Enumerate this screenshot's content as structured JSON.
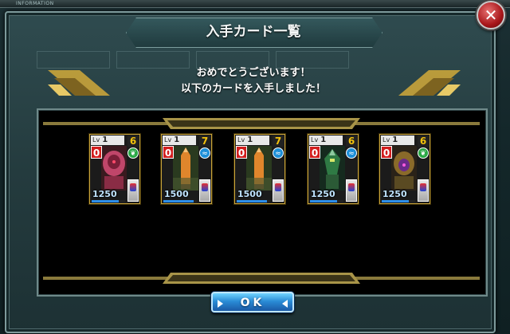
{
  "top_bar": {
    "label": "INFORMATION"
  },
  "dialog": {
    "title": "入手カード一覧",
    "message_line1": "おめでとうございます！",
    "message_line2": "以下のカードを入手しました！",
    "ok_label": "OK",
    "close_symbol": "✕"
  },
  "icons": {
    "close": "close-icon",
    "ok_arrows": "triangle-arrow-icon",
    "attribute_green": "leaf-icon",
    "attribute_blue": "wave-icon"
  },
  "colors": {
    "accent_gold": "#c9a43a",
    "attack_red": "#d21e1e",
    "cost_yellow": "#f3c20c",
    "button_blue": "#2a8cd6",
    "attr_green": "#2aa845",
    "attr_blue": "#1d8fd8"
  },
  "cards": [
    {
      "lv_label": "Lv",
      "level": "1",
      "cost": "6",
      "attack": "0",
      "hp": "1250",
      "attribute": "green",
      "hp_fill": 0.8,
      "art": "pink-mobile-suit"
    },
    {
      "lv_label": "Lv",
      "level": "1",
      "cost": "7",
      "attack": "0",
      "hp": "1500",
      "attribute": "blue",
      "hp_fill": 0.9,
      "art": "orange-missile"
    },
    {
      "lv_label": "Lv",
      "level": "1",
      "cost": "7",
      "attack": "0",
      "hp": "1500",
      "attribute": "blue",
      "hp_fill": 0.9,
      "art": "orange-missile"
    },
    {
      "lv_label": "Lv",
      "level": "1",
      "cost": "6",
      "attack": "0",
      "hp": "1250",
      "attribute": "blue",
      "hp_fill": 0.8,
      "art": "green-mobile-suit"
    },
    {
      "lv_label": "Lv",
      "level": "1",
      "cost": "6",
      "attack": "0",
      "hp": "1250",
      "attribute": "green",
      "hp_fill": 0.8,
      "art": "purple-gold-mobile-suit"
    }
  ]
}
